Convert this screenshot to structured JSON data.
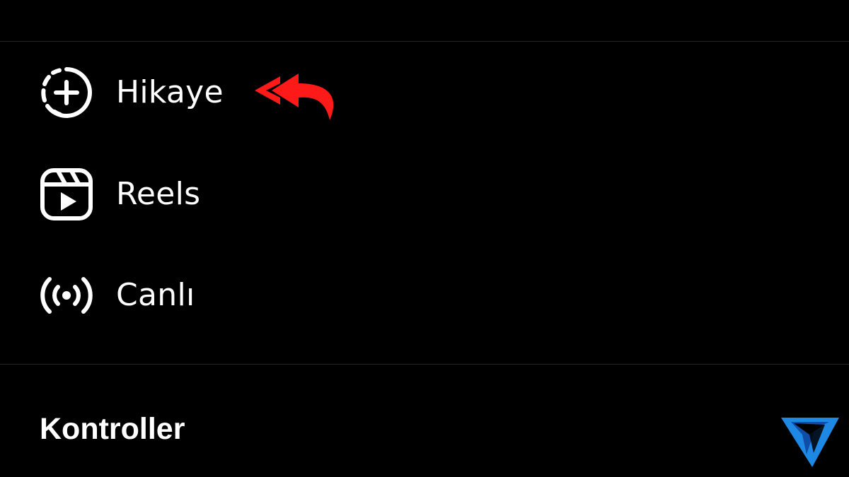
{
  "menu": {
    "items": [
      {
        "label": "Hikaye",
        "icon": "story-add-icon"
      },
      {
        "label": "Reels",
        "icon": "reels-icon"
      },
      {
        "label": "Canlı",
        "icon": "live-broadcast-icon"
      }
    ]
  },
  "section": {
    "title": "Kontroller"
  },
  "annotation": {
    "arrow_icon": "pointer-arrow-icon",
    "arrow_color": "#ff1a1a"
  },
  "branding": {
    "logo_icon": "brand-logo-icon",
    "logo_color": "#1e88e5"
  },
  "theme": {
    "background": "#000000",
    "text": "#ffffff",
    "divider": "#262626"
  }
}
